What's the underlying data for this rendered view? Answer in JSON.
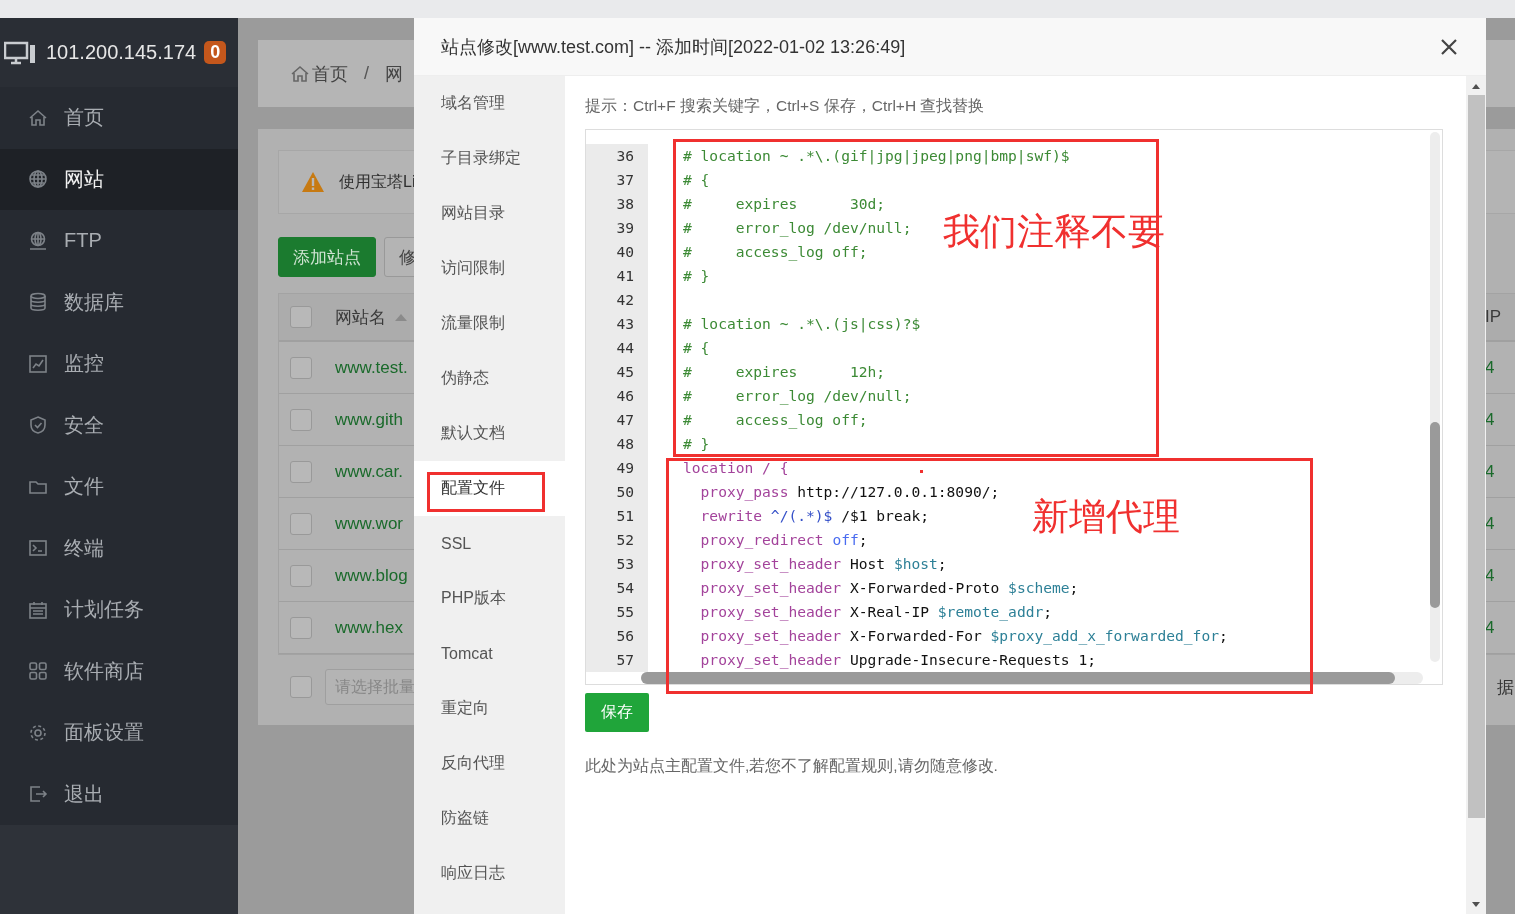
{
  "server": {
    "ip": "101.200.145.174",
    "badge": "0"
  },
  "sidebar": {
    "items": [
      {
        "label": "首页",
        "selected": false
      },
      {
        "label": "网站",
        "selected": true
      },
      {
        "label": "FTP",
        "selected": false
      },
      {
        "label": "数据库",
        "selected": false
      },
      {
        "label": "监控",
        "selected": false
      },
      {
        "label": "安全",
        "selected": false
      },
      {
        "label": "文件",
        "selected": false
      },
      {
        "label": "终端",
        "selected": false
      },
      {
        "label": "计划任务",
        "selected": false
      },
      {
        "label": "软件商店",
        "selected": false
      },
      {
        "label": "面板设置",
        "selected": false
      },
      {
        "label": "退出",
        "selected": false
      }
    ]
  },
  "page": {
    "breadcrumb": {
      "home": "首页",
      "separator": "/",
      "current": "网"
    },
    "alert": "使用宝塔Li",
    "buttons": [
      {
        "label": "添加站点",
        "kind": "primary"
      },
      {
        "label": "修",
        "kind": "default"
      }
    ],
    "table": {
      "columns": [
        "网站名",
        "IP"
      ],
      "header_checked": false,
      "rows": [
        {
          "checked": false,
          "name": "www.test.",
          "ip": "4"
        },
        {
          "checked": false,
          "name": "www.gith",
          "ip": "4"
        },
        {
          "checked": false,
          "name": "www.car.",
          "ip": "4"
        },
        {
          "checked": false,
          "name": "www.wor",
          "ip": "4"
        },
        {
          "checked": false,
          "name": "www.blog",
          "ip": "4"
        },
        {
          "checked": false,
          "name": "www.hex",
          "ip": "4"
        }
      ],
      "footer_checked": false,
      "batch_placeholder": "请选择批量",
      "footer_text": "据"
    }
  },
  "dialog": {
    "title": "站点修改[www.test.com] -- 添加时间[2022-01-02 13:26:49]",
    "menu": [
      {
        "label": "域名管理",
        "selected": false
      },
      {
        "label": "子目录绑定",
        "selected": false
      },
      {
        "label": "网站目录",
        "selected": false
      },
      {
        "label": "访问限制",
        "selected": false
      },
      {
        "label": "流量限制",
        "selected": false
      },
      {
        "label": "伪静态",
        "selected": false
      },
      {
        "label": "默认文档",
        "selected": false
      },
      {
        "label": "配置文件",
        "selected": true
      },
      {
        "label": "SSL",
        "selected": false
      },
      {
        "label": "PHP版本",
        "selected": false
      },
      {
        "label": "Tomcat",
        "selected": false
      },
      {
        "label": "重定向",
        "selected": false
      },
      {
        "label": "反向代理",
        "selected": false
      },
      {
        "label": "防盗链",
        "selected": false
      },
      {
        "label": "响应日志",
        "selected": false
      }
    ],
    "hint": "提示：Ctrl+F 搜索关键字，Ctrl+S 保存，Ctrl+H 查找替换",
    "editor": {
      "lines": [
        {
          "number": "36",
          "tokens": [
            {
              "kind": "comment",
              "text": "# location ~ .*\\.(gif|jpg|jpeg|png|bmp|swf)$"
            }
          ]
        },
        {
          "number": "37",
          "tokens": [
            {
              "kind": "comment",
              "text": "# {"
            }
          ]
        },
        {
          "number": "38",
          "tokens": [
            {
              "kind": "comment",
              "text": "#     expires      30d;"
            }
          ]
        },
        {
          "number": "39",
          "tokens": [
            {
              "kind": "comment",
              "text": "#     error_log /dev/null;"
            }
          ]
        },
        {
          "number": "40",
          "tokens": [
            {
              "kind": "comment",
              "text": "#     access_log off;"
            }
          ]
        },
        {
          "number": "41",
          "tokens": [
            {
              "kind": "comment",
              "text": "# }"
            }
          ]
        },
        {
          "number": "42"
        },
        {
          "number": "43",
          "tokens": [
            {
              "kind": "comment",
              "text": "# location ~ .*\\.(js|css)?$"
            }
          ]
        },
        {
          "number": "44",
          "tokens": [
            {
              "kind": "comment",
              "text": "# {"
            }
          ]
        },
        {
          "number": "45",
          "tokens": [
            {
              "kind": "comment",
              "text": "#     expires      12h;"
            }
          ]
        },
        {
          "number": "46",
          "tokens": [
            {
              "kind": "comment",
              "text": "#     error_log /dev/null;"
            }
          ]
        },
        {
          "number": "47",
          "tokens": [
            {
              "kind": "comment",
              "text": "#     access_log off;"
            }
          ]
        },
        {
          "number": "48",
          "tokens": [
            {
              "kind": "comment",
              "text": "# }"
            }
          ]
        },
        {
          "number": "49",
          "tokens": [
            {
              "kind": "keyword",
              "text": "location / {"
            }
          ]
        },
        {
          "number": "50",
          "tokens": [
            {
              "kind": "keyword",
              "text": "  proxy_pass"
            },
            {
              "kind": "plain",
              "text": " http://127.0.0.1:8090/;"
            }
          ]
        },
        {
          "number": "51",
          "tokens": [
            {
              "kind": "keyword",
              "text": "  rewrite"
            },
            {
              "kind": "regex",
              "text": " ^/(.*)$"
            },
            {
              "kind": "plain",
              "text": " /$1 break;"
            }
          ]
        },
        {
          "number": "52",
          "tokens": [
            {
              "kind": "keyword",
              "text": "  proxy_redirect"
            },
            {
              "kind": "atom",
              "text": " off"
            },
            {
              "kind": "plain",
              "text": ";"
            }
          ]
        },
        {
          "number": "53",
          "tokens": [
            {
              "kind": "keyword",
              "text": "  proxy_set_header"
            },
            {
              "kind": "plain",
              "text": " Host "
            },
            {
              "kind": "variable",
              "text": "$host"
            },
            {
              "kind": "plain",
              "text": ";"
            }
          ]
        },
        {
          "number": "54",
          "tokens": [
            {
              "kind": "keyword",
              "text": "  proxy_set_header"
            },
            {
              "kind": "plain",
              "text": " X-Forwarded-Proto "
            },
            {
              "kind": "variable",
              "text": "$scheme"
            },
            {
              "kind": "plain",
              "text": ";"
            }
          ]
        },
        {
          "number": "55",
          "tokens": [
            {
              "kind": "keyword",
              "text": "  proxy_set_header"
            },
            {
              "kind": "plain",
              "text": " X-Real-IP "
            },
            {
              "kind": "variable",
              "text": "$remote_addr"
            },
            {
              "kind": "plain",
              "text": ";"
            }
          ]
        },
        {
          "number": "56",
          "tokens": [
            {
              "kind": "keyword",
              "text": "  proxy_set_header"
            },
            {
              "kind": "plain",
              "text": " X-Forwarded-For "
            },
            {
              "kind": "variable",
              "text": "$proxy_add_x_forwarded_for"
            },
            {
              "kind": "plain",
              "text": ";"
            }
          ]
        },
        {
          "number": "57",
          "tokens": [
            {
              "kind": "keyword",
              "text": "  proxy_set_header"
            },
            {
              "kind": "plain",
              "text": " Upgrade-Insecure-Requests 1;"
            }
          ]
        }
      ]
    },
    "save_button": "保存",
    "note": "此处为站点主配置文件,若您不了解配置规则,请勿随意修改."
  },
  "annotations": {
    "labels": [
      "我们注释不要",
      "新增代理"
    ]
  }
}
